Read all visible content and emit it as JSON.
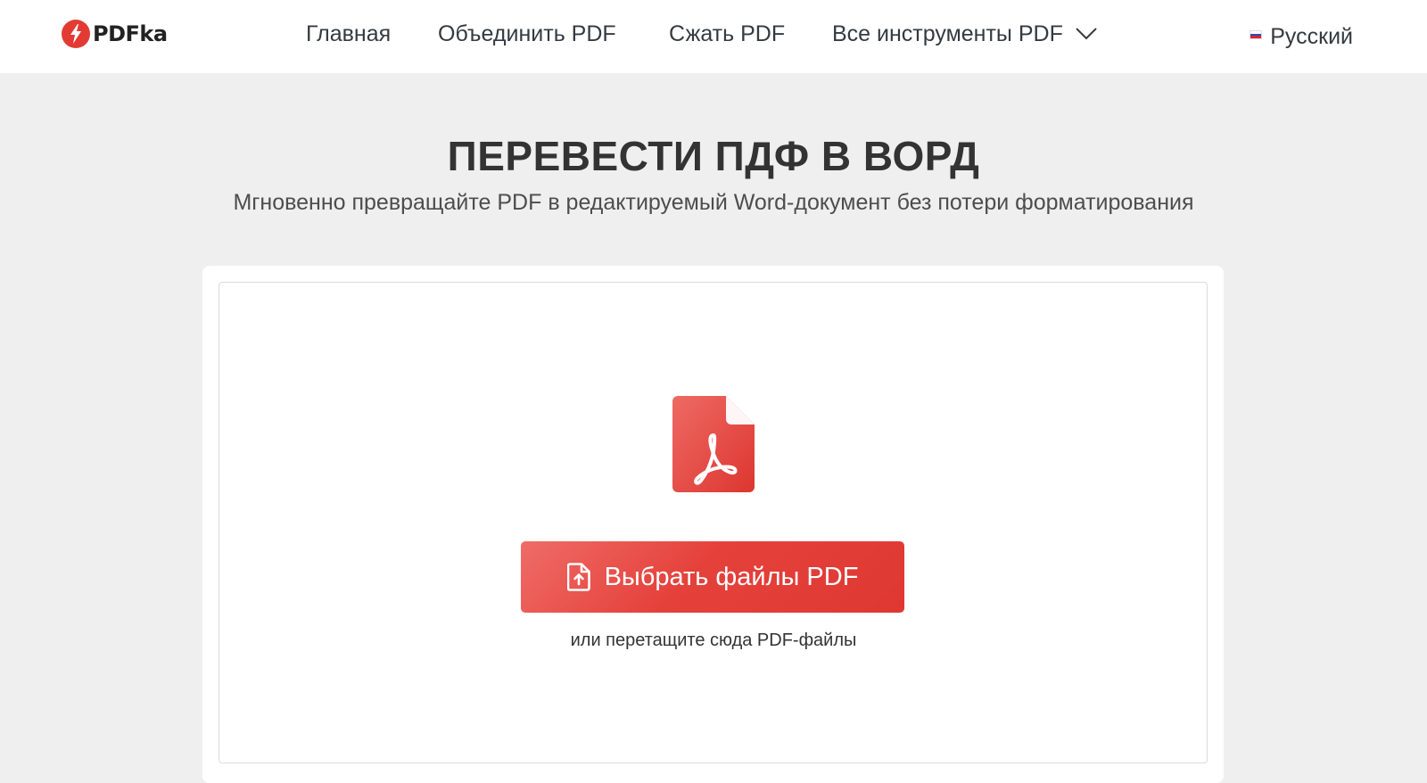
{
  "header": {
    "logo_text": "PDFka",
    "nav": [
      {
        "label": "Главная"
      },
      {
        "label": "Объединить PDF"
      },
      {
        "label": "Сжать PDF"
      },
      {
        "label": "Все инструменты PDF"
      }
    ],
    "language": "Русский"
  },
  "main": {
    "title": "ПЕРЕВЕСТИ ПДФ В ВОРД",
    "subtitle": "Мгновенно превращайте PDF в редактируемый Word-документ без потери форматирования",
    "upload_button_label": "Выбрать файлы PDF",
    "drop_hint": "или перетащите сюда PDF-файлы"
  },
  "icons": {
    "logo": "lightning-bolt-icon",
    "dropdown": "chevron-down-icon",
    "flag": "russia-flag-icon",
    "pdf": "pdf-file-icon",
    "upload": "file-upload-icon"
  },
  "colors": {
    "accent": "#e23b33",
    "background": "#efefef",
    "header_bg": "#ffffff",
    "text": "#333333"
  }
}
